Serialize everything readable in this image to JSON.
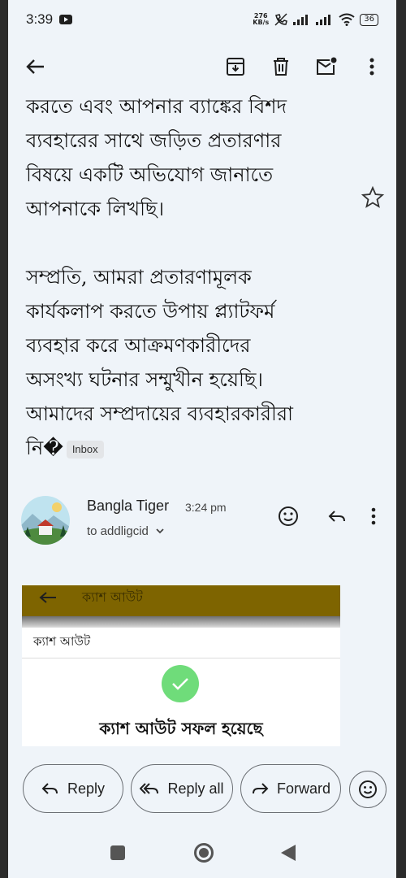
{
  "status_bar": {
    "time": "3:39",
    "net_speed_value": "276",
    "net_speed_unit": "KB/s",
    "battery": "36"
  },
  "toolbar": {
    "icons": [
      "back-arrow-icon",
      "archive-icon",
      "delete-icon",
      "mark-unread-icon",
      "more-vert-icon"
    ]
  },
  "message": {
    "paragraph1_lines": [
      "করতে এবং আপনার ব্যাঙ্কের বিশদ",
      "ব্যবহারের সাথে জড়িত প্রতারণার",
      "বিষয়ে একটি অভিযোগ জানাতে",
      "আপনাকে লিখছি।"
    ],
    "paragraph2_lines": [
      "সম্প্রতি, আমরা প্রতারণামূলক",
      "কার্যকলাপ করতে উপায় প্ল্যাটফর্ম",
      "ব্যবহার করে আক্রমণকারীদের",
      "অসংখ্য ঘটনার সম্মুখীন হয়েছি।",
      "আমাদের সম্প্রদায়ের ব্যবহারকারীরা"
    ],
    "last_line": "নি�",
    "label_chip": "Inbox"
  },
  "sender": {
    "name": "Bangla Tiger",
    "time": "3:24 pm",
    "to": "to addligcid"
  },
  "attachment": {
    "bar_title": "ক্যাশ আউট",
    "subtitle": "ক্যাশ আউট",
    "success_text": "ক্যাশ আউট সফল হয়েছে",
    "bar_color": "#7e6400",
    "check_color": "#6fdc7a"
  },
  "actions": {
    "reply": "Reply",
    "reply_all": "Reply all",
    "forward": "Forward"
  }
}
